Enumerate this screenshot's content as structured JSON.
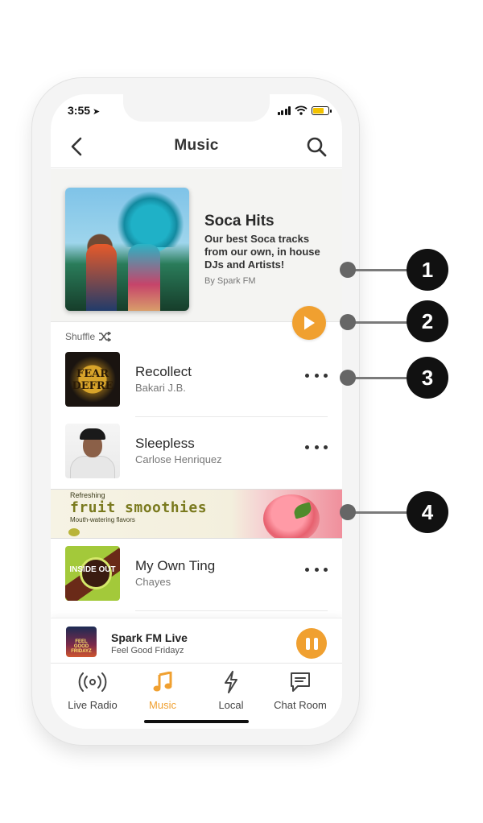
{
  "status_bar": {
    "time": "3:55",
    "location_glyph": "➤"
  },
  "header": {
    "title": "Music"
  },
  "playlist": {
    "title": "Soca Hits",
    "description": "Our best Soca tracks from our own, in house DJs and Artists!",
    "byline": "By Spark FM"
  },
  "shuffle_label": "Shuffle",
  "tracks": [
    {
      "title": "Recollect",
      "artist": "Bakari J.B.",
      "art_text": "FEAR DEFRE"
    },
    {
      "title": "Sleepless",
      "artist": "Carlose Henriquez"
    },
    {
      "title": "My Own Ting",
      "artist": "Chayes",
      "art_text": "INSIDE OUT"
    }
  ],
  "ad": {
    "line1": "Refreshing",
    "headline": "fruit smoothies",
    "line2": "Mouth-watering flavors"
  },
  "now_playing": {
    "title": "Spark FM Live",
    "subtitle": "Feel Good Fridayz",
    "art_text": "FEEL GOOD FRIDAYZ"
  },
  "tabs": [
    {
      "label": "Live Radio",
      "icon": "broadcast-icon",
      "active": false
    },
    {
      "label": "Music",
      "icon": "music-note-icon",
      "active": true
    },
    {
      "label": "Local",
      "icon": "lightning-icon",
      "active": false
    },
    {
      "label": "Chat Room",
      "icon": "chat-icon",
      "active": false
    }
  ],
  "callouts": [
    "1",
    "2",
    "3",
    "4"
  ],
  "colors": {
    "accent": "#f0a030",
    "callout": "#111111",
    "connector": "#777777"
  }
}
